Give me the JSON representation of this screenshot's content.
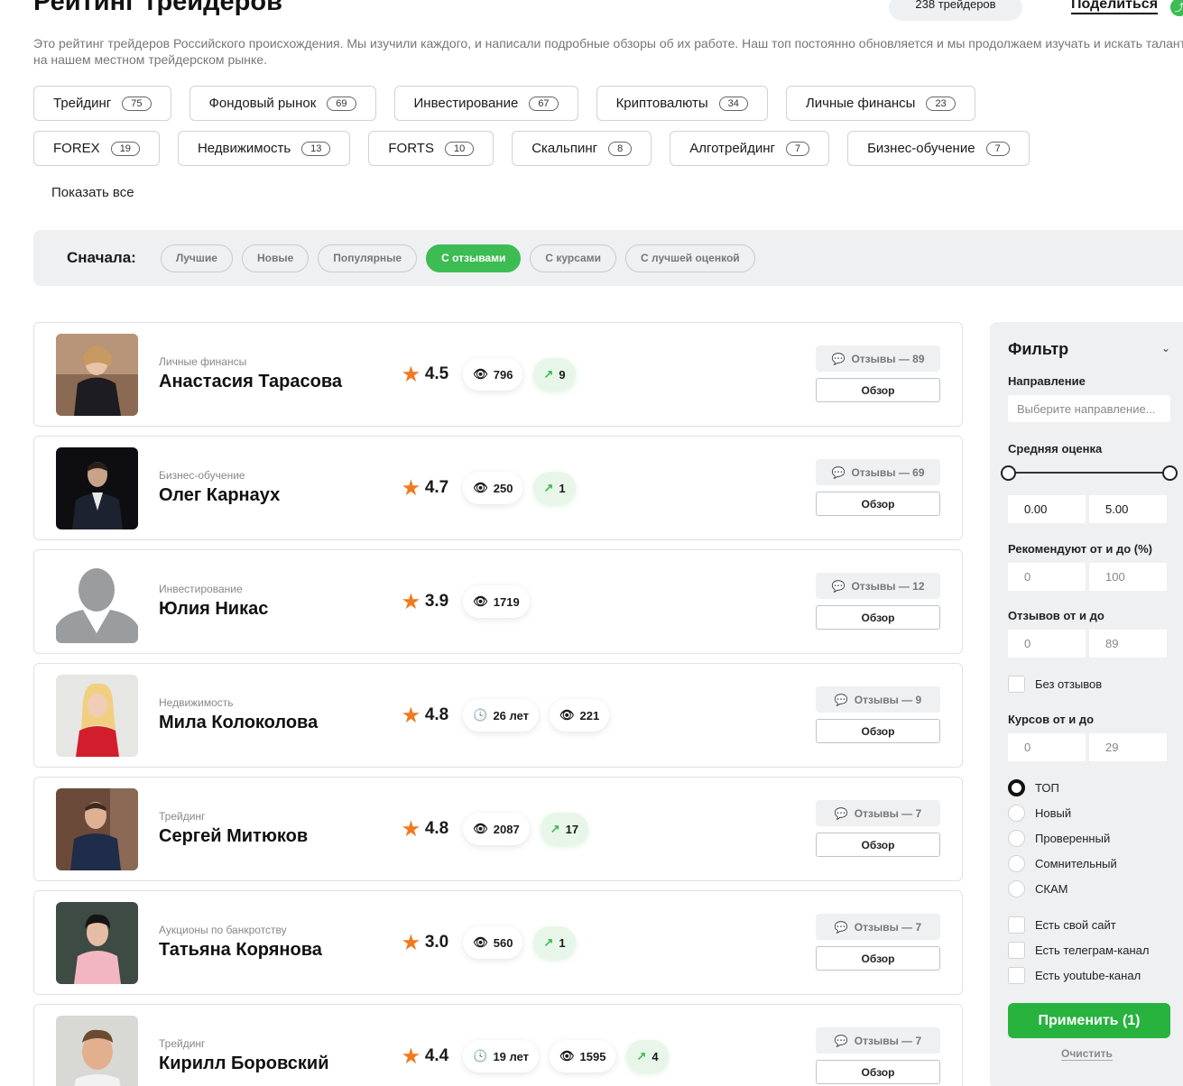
{
  "header": {
    "title": "Рейтинг трейдеров",
    "count": "238 трейдеров",
    "share": "Поделиться"
  },
  "intro": "Это рейтинг трейдеров Российского происхождения. Мы изучили каждого, и написали подробные обзоры об их работе. Наш топ постоянно обновляется и мы продолжаем изучать и искать таланты на нашем местном трейдерском рынке.",
  "categories": [
    {
      "label": "Трейдинг",
      "count": "75"
    },
    {
      "label": "Фондовый рынок",
      "count": "69"
    },
    {
      "label": "Инвестирование",
      "count": "67"
    },
    {
      "label": "Криптовалюты",
      "count": "34"
    },
    {
      "label": "Личные финансы",
      "count": "23"
    },
    {
      "label": "FOREX",
      "count": "19"
    },
    {
      "label": "Недвижимость",
      "count": "13"
    },
    {
      "label": "FORTS",
      "count": "10"
    },
    {
      "label": "Скальпинг",
      "count": "8"
    },
    {
      "label": "Алготрейдинг",
      "count": "7"
    },
    {
      "label": "Бизнес-обучение",
      "count": "7"
    }
  ],
  "show_all": "Показать все",
  "sort": {
    "label": "Сначала:",
    "options": [
      "Лучшие",
      "Новые",
      "Популярные",
      "С отзывами",
      "С курсами",
      "С лучшей оценкой"
    ],
    "active": "С отзывами"
  },
  "traders": [
    {
      "category": "Личные финансы",
      "name": "Анастасия Тарасова",
      "rating": "4.5",
      "views": "796",
      "trend": "9",
      "reviews": "Отзывы — 89",
      "review_btn": "Обзор"
    },
    {
      "category": "Бизнес-обучение",
      "name": "Олег Карнаух",
      "rating": "4.7",
      "views": "250",
      "trend": "1",
      "reviews": "Отзывы — 69",
      "review_btn": "Обзор"
    },
    {
      "category": "Инвестирование",
      "name": "Юлия Никас",
      "rating": "3.9",
      "views": "1719",
      "reviews": "Отзывы — 12",
      "review_btn": "Обзор"
    },
    {
      "category": "Недвижимость",
      "name": "Мила Колоколова",
      "rating": "4.8",
      "years": "26 лет",
      "views": "221",
      "reviews": "Отзывы — 9",
      "review_btn": "Обзор"
    },
    {
      "category": "Трейдинг",
      "name": "Сергей Митюков",
      "rating": "4.8",
      "views": "2087",
      "trend": "17",
      "reviews": "Отзывы — 7",
      "review_btn": "Обзор"
    },
    {
      "category": "Аукционы по банкротству",
      "name": "Татьяна Корянова",
      "rating": "3.0",
      "views": "560",
      "trend": "1",
      "reviews": "Отзывы — 7",
      "review_btn": "Обзор"
    },
    {
      "category": "Трейдинг",
      "name": "Кирилл Боровский",
      "rating": "4.4",
      "years": "19 лет",
      "views": "1595",
      "trend": "4",
      "reviews": "Отзывы — 7",
      "review_btn": "Обзор"
    }
  ],
  "filter": {
    "title": "Фильтр",
    "direction_label": "Направление",
    "direction_placeholder": "Выберите направление...",
    "avg_label": "Средняя оценка",
    "avg_min": "0.00",
    "avg_max": "5.00",
    "recommend_label": "Рекомендуют от и до (%)",
    "recommend_min": "0",
    "recommend_max": "100",
    "reviews_label": "Отзывов от и до",
    "reviews_min": "0",
    "reviews_max": "89",
    "no_reviews": "Без отзывов",
    "courses_label": "Курсов от и до",
    "courses_min": "0",
    "courses_max": "29",
    "statuses": [
      "ТОП",
      "Новый",
      "Проверенный",
      "Сомнительный",
      "СКАМ"
    ],
    "status_selected": "ТОП",
    "extras": [
      "Есть свой сайт",
      "Есть телеграм-канал",
      "Есть youtube-канал"
    ],
    "apply": "Применить (1)",
    "clear": "Очистить"
  },
  "colors": {
    "accent": "#3cbc52",
    "star": "#f07a1f",
    "panel": "#eef0f1"
  }
}
